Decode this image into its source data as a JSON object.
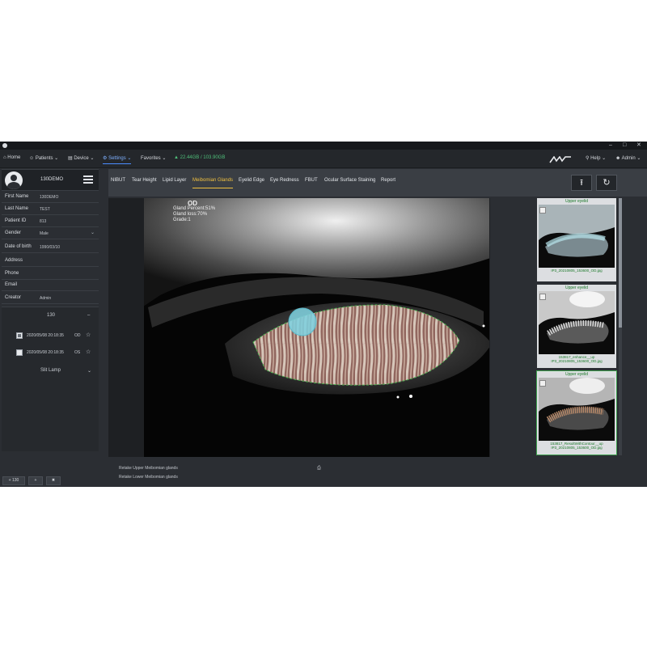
{
  "app": {
    "title": "",
    "window_controls": [
      "–",
      "□",
      "✕"
    ]
  },
  "menu": {
    "items": [
      {
        "id": "home",
        "label": "Home",
        "icon": "home-icon"
      },
      {
        "id": "patients",
        "label": "Patients",
        "icon": "people-icon"
      },
      {
        "id": "device",
        "label": "Device",
        "icon": "device-icon"
      },
      {
        "id": "settings",
        "label": "Settings",
        "icon": "gear-icon",
        "active": true
      },
      {
        "id": "favorites",
        "label": "Favorites",
        "icon": ""
      }
    ],
    "storage": "22.44GB / 103.90GB",
    "help": "Help",
    "user": "Admin"
  },
  "patient": {
    "id_label": "130DEMO",
    "fields": [
      {
        "label": "First Name",
        "value": "130DEMO"
      },
      {
        "label": "Last Name",
        "value": "TEST"
      },
      {
        "label": "Patient ID",
        "value": "813"
      },
      {
        "label": "Gender",
        "value": "Male",
        "dropdown": true
      },
      {
        "label": "Date of birth",
        "value": "1990/03/10"
      },
      {
        "label": "Address",
        "value": ""
      },
      {
        "label": "Phone",
        "value": ""
      },
      {
        "label": "Email",
        "value": ""
      },
      {
        "label": "Creator",
        "value": "Admin"
      }
    ]
  },
  "exams": {
    "group": "130",
    "rows": [
      {
        "date": "2020/05/08 20:18:35",
        "eye": "OD",
        "checked": true
      },
      {
        "date": "2020/05/08 20:18:35",
        "eye": "OS",
        "checked": false
      }
    ],
    "device": "Slit Lamp"
  },
  "left_buttons": [
    "+ 130",
    "+",
    "✖"
  ],
  "tabs": [
    {
      "label": "NIBUT"
    },
    {
      "label": "Tear Height"
    },
    {
      "label": "Lipid Layer"
    },
    {
      "label": "Meibomian Glands",
      "active": true
    },
    {
      "label": "Eyelid Edge"
    },
    {
      "label": "Eye Redness"
    },
    {
      "label": "FBUT"
    },
    {
      "label": "Ocular Surface Staining"
    },
    {
      "label": "Report"
    }
  ],
  "toolbar": {
    "upload_icon": "⭱",
    "refresh_icon": "↻"
  },
  "analysis": {
    "eye": "OD",
    "gland_percent": "Gland Percent:51%",
    "gland_loss": "Gland loss:70%",
    "grade": "Grade:1"
  },
  "thumbnails": [
    {
      "caption": "Upper eyelid",
      "file": "IP3_20210805_153600_OD.jpg",
      "selected": false
    },
    {
      "caption": "Upper eyelid",
      "file": "153817_enhance__up IP3_20210805_153600_OD.jpg",
      "selected": false
    },
    {
      "caption": "Upper eyelid",
      "file": "153817_ResultWithContour__up IP3_20210805_153600_OD.jpg",
      "selected": true
    }
  ],
  "footer": {
    "line1": "Retake Upper Meibomian glands",
    "line2": "Retake Lower Meibomian glands",
    "print_icon": "⎙"
  },
  "colors": {
    "accent_tab": "#f0c040",
    "menu_active": "#4a8cff",
    "storage": "#4fbf7a",
    "thumb_caption": "#1c7a2a"
  }
}
